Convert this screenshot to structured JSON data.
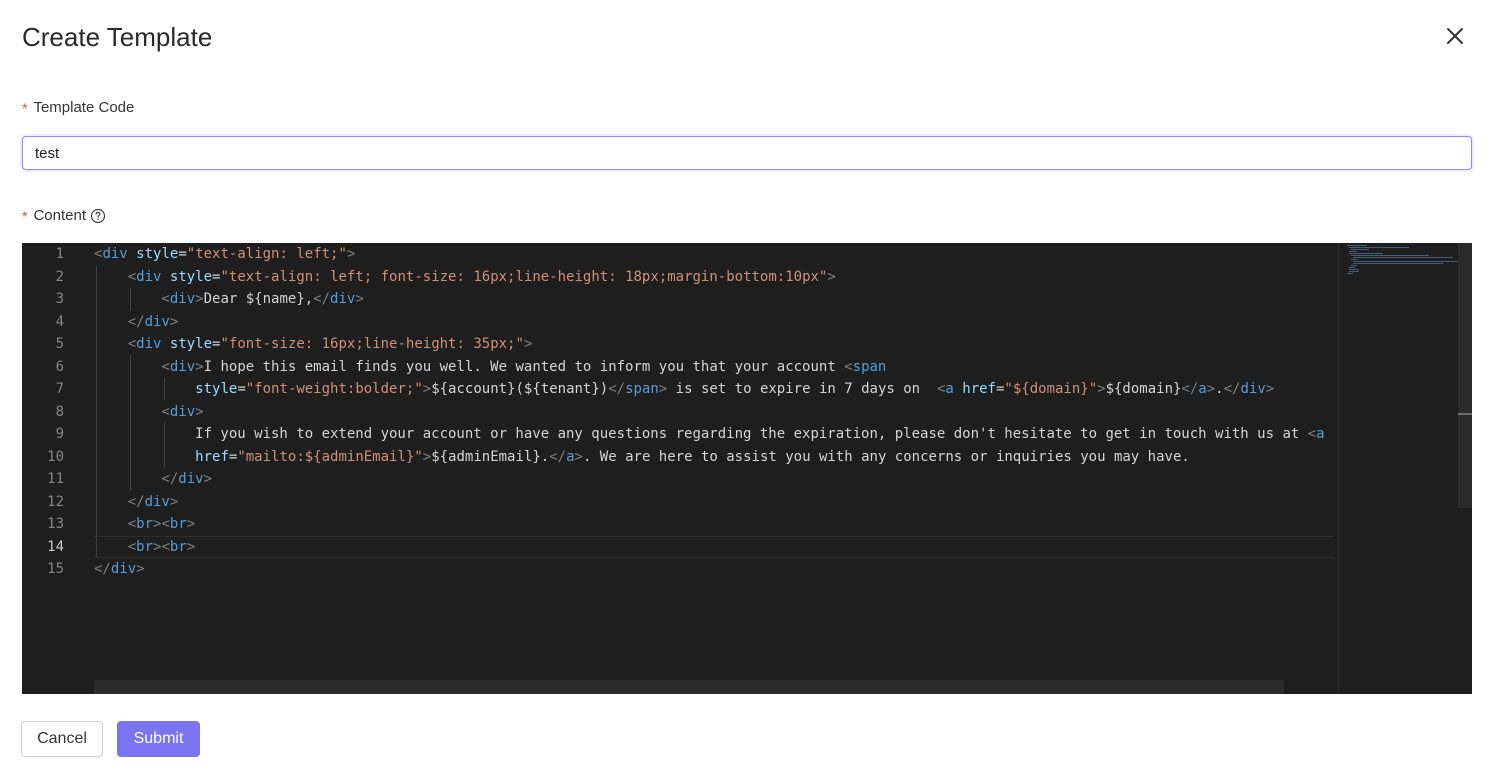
{
  "dialog": {
    "title": "Create Template",
    "close_icon": "close-icon"
  },
  "form": {
    "template_code": {
      "label": "Template Code",
      "required_marker": "*",
      "value": "test",
      "placeholder": ""
    },
    "content": {
      "label": "Content",
      "required_marker": "*",
      "help_icon": "question-circle-icon"
    }
  },
  "editor": {
    "active_line": 14,
    "line_numbers": [
      "1",
      "2",
      "3",
      "4",
      "5",
      "6",
      "7",
      "8",
      "9",
      "10",
      "11",
      "12",
      "13",
      "14",
      "15"
    ],
    "lines": [
      "<div style=\"text-align: left;\">",
      "    <div style=\"text-align: left; font-size: 16px;line-height: 18px;margin-bottom:10px\">",
      "        <div>Dear ${name},</div>",
      "    </div>",
      "    <div style=\"font-size: 16px;line-height: 35px;\">",
      "        <div>I hope this email finds you well. We wanted to inform you that your account <span",
      "            style=\"font-weight:bolder;\">${account}(${tenant})</span> is set to expire in 7 days on  <a href=\"${domain}\">${domain}</a>.</div>",
      "        <div>",
      "            If you wish to extend your account or have any questions regarding the expiration, please don't hesitate to get in touch with us at <a",
      "            href=\"mailto:${adminEmail}\">${adminEmail}.</a>. We are here to assist you with any concerns or inquiries you may have.",
      "        </div>",
      "    </div>",
      "    <br><br>",
      "    <br><br>",
      "</div>"
    ]
  },
  "footer": {
    "cancel_label": "Cancel",
    "submit_label": "Submit"
  },
  "colors": {
    "accent": "#7a74f0",
    "required": "#e74c3c",
    "editor_bg": "#1e1e1e"
  }
}
